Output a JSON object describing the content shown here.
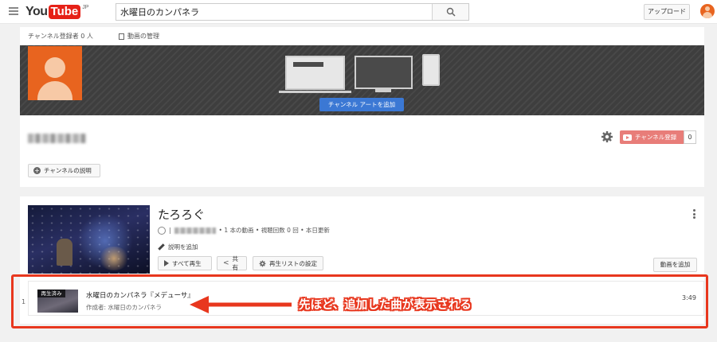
{
  "header": {
    "logo_you": "You",
    "logo_tube": "Tube",
    "logo_region": "JP",
    "search_value": "水曜日のカンパネラ",
    "upload_label": "アップロード"
  },
  "subbar": {
    "subscriber_count": "チャンネル登録者 0 人",
    "manage_videos": "動画の管理"
  },
  "banner": {
    "add_art_button": "チャンネル アートを追加"
  },
  "channel": {
    "subscribe_label": "チャンネル登録",
    "subscribe_count": "0",
    "about_button": "チャンネルの説明"
  },
  "playlist": {
    "title": "たろろぐ",
    "meta_suffix": "• 1 本の動画 • 視聴回数 0 回 • 本日更新",
    "add_description": "説明を追加",
    "play_all": "すべて再生",
    "share": "共有",
    "settings": "再生リストの設定",
    "add_video": "動画を追加"
  },
  "videos": [
    {
      "index": "1",
      "thumb_label": "再生済み",
      "title": "水曜日のカンパネラ『メデューサ』",
      "author": "作成者: 水曜日のカンパネラ",
      "duration": "3:49"
    }
  ],
  "annotation": {
    "text": "先ほど、追加した曲が表示される",
    "color": "#e8371e"
  },
  "colors": {
    "youtube_red": "#e62117",
    "accent_blue": "#3b78d4",
    "avatar_orange": "#e8641f"
  }
}
